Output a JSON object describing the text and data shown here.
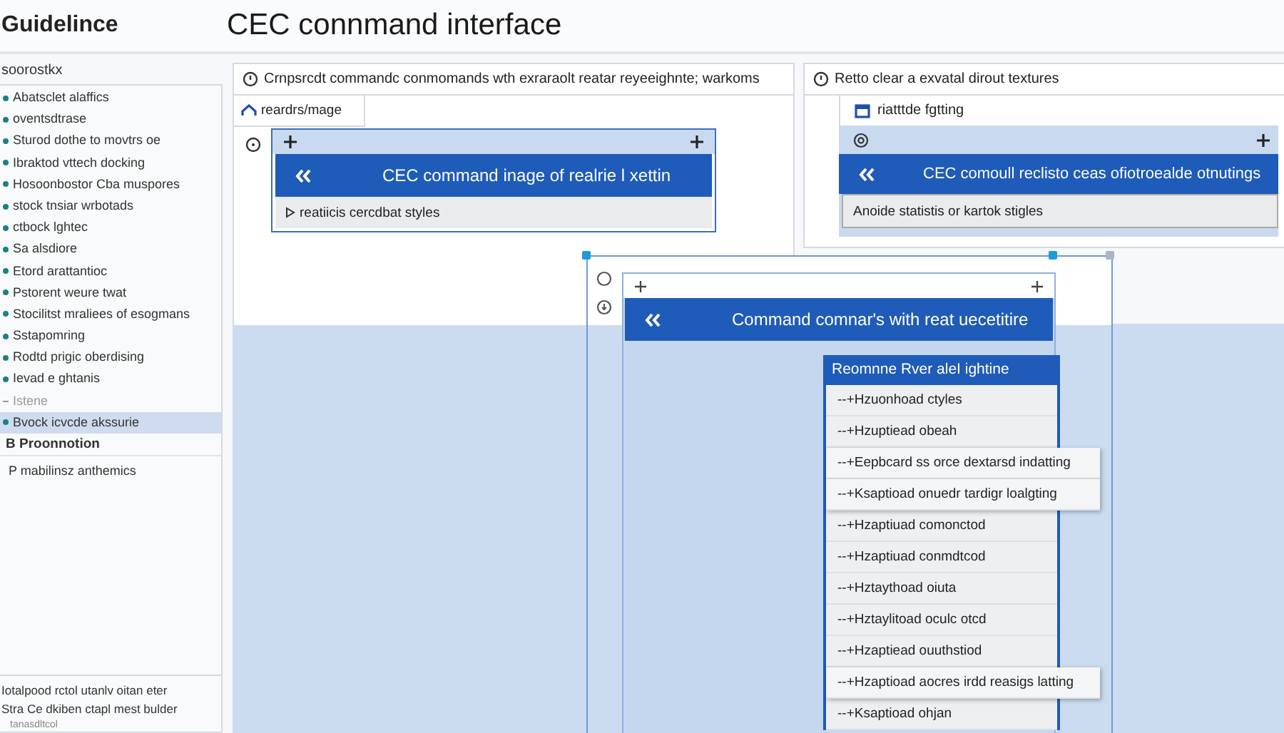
{
  "app_title": "Guidelince",
  "page_title": "CEC connmand interface",
  "sidebar": {
    "heading": "soorostkx",
    "items": [
      {
        "label": "Abatsclet alaffics",
        "kind": "bullet",
        "selected": false
      },
      {
        "label": "oventsdtrase",
        "kind": "bullet",
        "selected": false
      },
      {
        "label": "Sturod dothe to movtrs oe",
        "kind": "bullet",
        "selected": false
      },
      {
        "label": "Ibraktod vttech docking",
        "kind": "bullet",
        "selected": false
      },
      {
        "label": "Hosoonbostor Cba muspores",
        "kind": "bullet",
        "selected": false
      },
      {
        "label": "stock tnsiar wrbotads",
        "kind": "bullet",
        "selected": false
      },
      {
        "label": "ctbock lghtec",
        "kind": "bullet",
        "selected": false
      },
      {
        "label": "Sa alsdiore",
        "kind": "bullet",
        "selected": false
      },
      {
        "label": "Etord arattantioc",
        "kind": "bullet",
        "selected": false
      },
      {
        "label": "Pstorent weure twat",
        "kind": "bullet",
        "selected": false
      },
      {
        "label": "Stocilitst mraliees of esogmans",
        "kind": "bullet",
        "selected": false
      },
      {
        "label": "Sstapomring",
        "kind": "bullet",
        "selected": false
      },
      {
        "label": "Rodtd prigic oberdising",
        "kind": "bullet",
        "selected": false
      },
      {
        "label": "Ievad e ghtanis",
        "kind": "bullet",
        "selected": false
      },
      {
        "label": "Istene",
        "kind": "faded",
        "selected": false
      },
      {
        "label": "Bvock icvcde akssurie",
        "kind": "bullet",
        "selected": true
      },
      {
        "label": "B Proonnotion",
        "kind": "heading",
        "selected": false
      },
      {
        "label": "P  mabilinsz anthemics",
        "kind": "plain",
        "selected": false
      }
    ],
    "footer": [
      "Iotalpood rctol utanlv oitan eter",
      "Stra Ce dkiben ctapl mest bulder",
      "tanasdltcol"
    ]
  },
  "left_panel": {
    "header": "Crnpsrcdt commandc conmomands wth exraraolt reatar reyeeighnte; warkoms",
    "path": "reardrs/mage",
    "card": {
      "command": "CEC command inage of realrie l xettin",
      "footer": "reatiicis cercdbat styles"
    }
  },
  "right_panel": {
    "header": "Retto clear a exvatal dirout textures",
    "path": "riatttde fgtting",
    "card": {
      "command": "CEC comoull reclisto ceas ofiotroealde otnutings",
      "footer": "Anoide statistis or kartok stigles"
    }
  },
  "frame": {
    "command": "Command comnar's with reat uecetitire",
    "dropdown": {
      "header": "Reomnne Rver aleI ightine",
      "items": [
        {
          "label": "--+Hzuonhoad ctyles",
          "kind": "row"
        },
        {
          "label": "--+Hzuptiead obeah",
          "kind": "row"
        },
        {
          "label": "--+Eepbcard ss orce dextarsd indatting",
          "kind": "popout"
        },
        {
          "label": "--+Ksaptioad onuedr tardigr loalgting",
          "kind": "popout"
        },
        {
          "label": "--+Hzaptiuad comonctod",
          "kind": "row"
        },
        {
          "label": "--+Hzaptiuad conmdtcod",
          "kind": "row"
        },
        {
          "label": "--+Hztaythoad oiuta",
          "kind": "row"
        },
        {
          "label": "--+Hztaylitoad oculc otcd",
          "kind": "row"
        },
        {
          "label": "--+Hzaptiead ouuthstiod",
          "kind": "row"
        },
        {
          "label": "--+Hzaptioad aocres irdd reasigs latting",
          "kind": "popout"
        },
        {
          "label": "--+Ksaptioad ohjan",
          "kind": "row"
        }
      ]
    }
  }
}
